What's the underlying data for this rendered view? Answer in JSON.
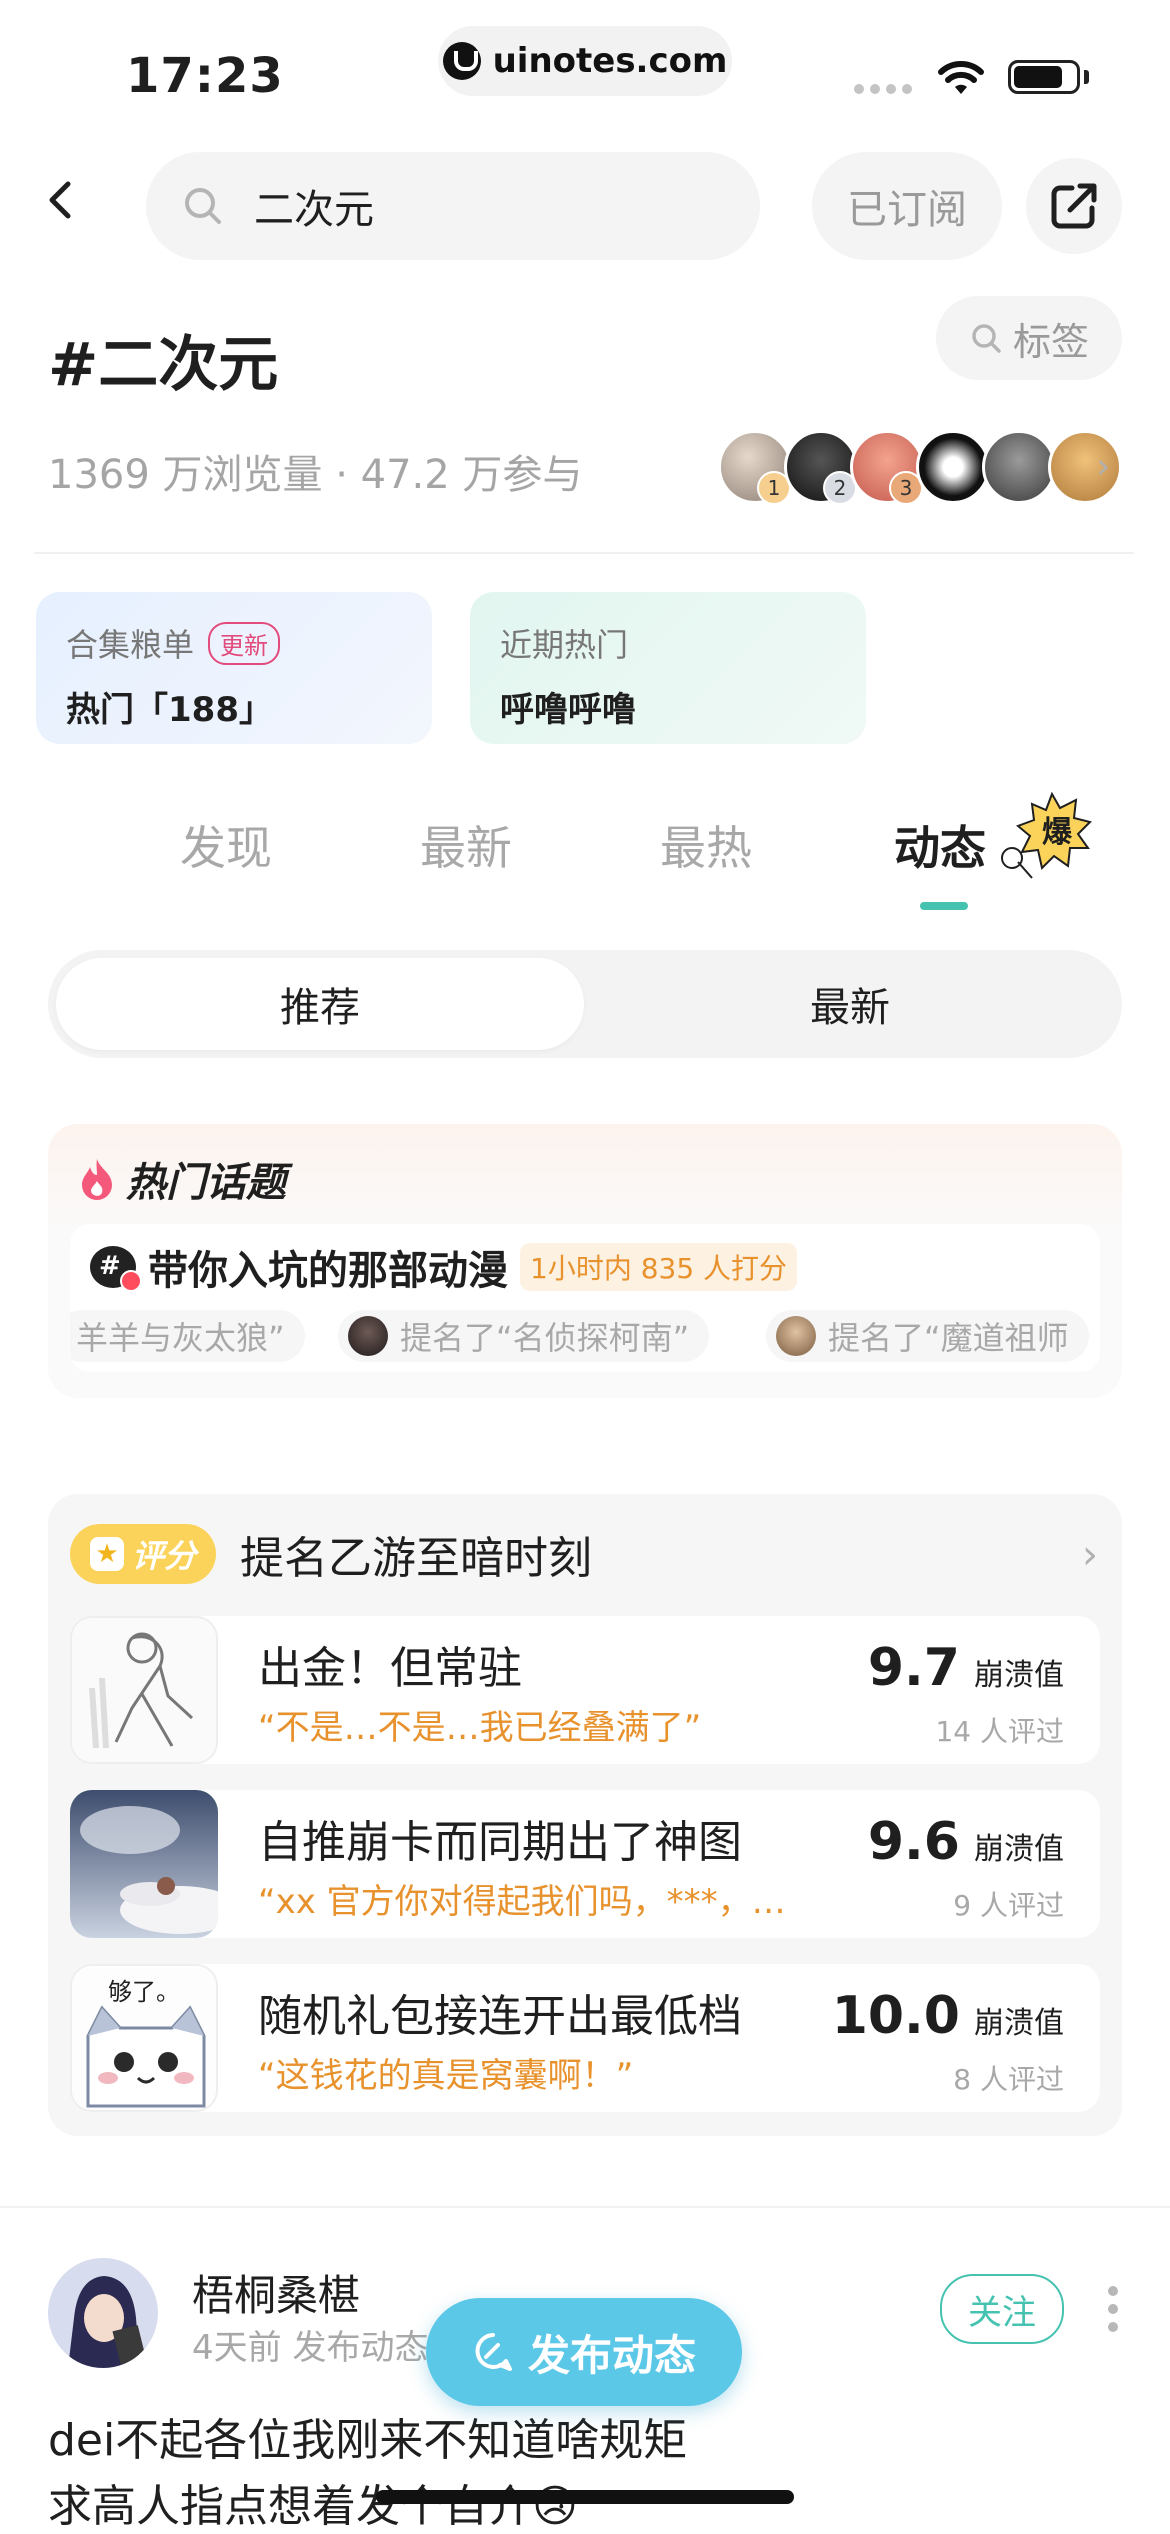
{
  "status_bar": {
    "time": "17:23",
    "url": "uinotes.com"
  },
  "nav": {
    "search_text": "二次元",
    "subscribed_label": "已订阅"
  },
  "topic": {
    "title": "#二次元",
    "tag_button": "标签",
    "stats": "1369 万浏览量 · 47.2 万参与",
    "avatar_ranks": [
      "1",
      "2",
      "3"
    ]
  },
  "cards": [
    {
      "label": "合集粮单",
      "badge": "更新",
      "value": "热门「188」"
    },
    {
      "label": "近期热门",
      "value": "呼噜呼噜"
    }
  ],
  "tabs": [
    "发现",
    "最新",
    "最热",
    "动态"
  ],
  "active_tab": "动态",
  "burst_badge": "爆",
  "segment": {
    "on": "推荐",
    "off": "最新"
  },
  "hot_topics": {
    "title": "热门话题",
    "topic": "带你入坑的那部动漫",
    "badge": "1小时内 835 人打分",
    "chips": [
      "羊羊与灰太狼”",
      "提名了“名侦探柯南”",
      "提名了“魔道祖师"
    ]
  },
  "rating": {
    "badge": "评分",
    "title": "提名乙游至暗时刻",
    "items": [
      {
        "title": "出金！但常驻",
        "quote": "“不是…不是…我已经叠满了”",
        "score": "9.7",
        "unit": "崩溃值",
        "count": "14 人评过"
      },
      {
        "title": "自推崩卡而同期出了神图",
        "quote": "“xx 官方你对得起我们吗，***，…",
        "score": "9.6",
        "unit": "崩溃值",
        "count": "9 人评过"
      },
      {
        "title": "随机礼包接连开出最低档",
        "quote": "“这钱花的真是窝囊啊！”",
        "score": "10.0",
        "unit": "崩溃值",
        "count": "8 人评过"
      }
    ],
    "thumb3_caption": "够了。"
  },
  "post": {
    "user": "梧桐桑椹",
    "meta": "4天前 发布动态",
    "follow": "关注",
    "line1": "dei不起各位我刚来不知道啥规矩",
    "line2": "求高人指点想着发个自介😢"
  },
  "publish_button": "发布动态",
  "colors": {
    "accent": "#45c2b0",
    "publish": "#5cc8e8",
    "orange": "#e8922e",
    "rating_badge": "#fbd35a"
  }
}
